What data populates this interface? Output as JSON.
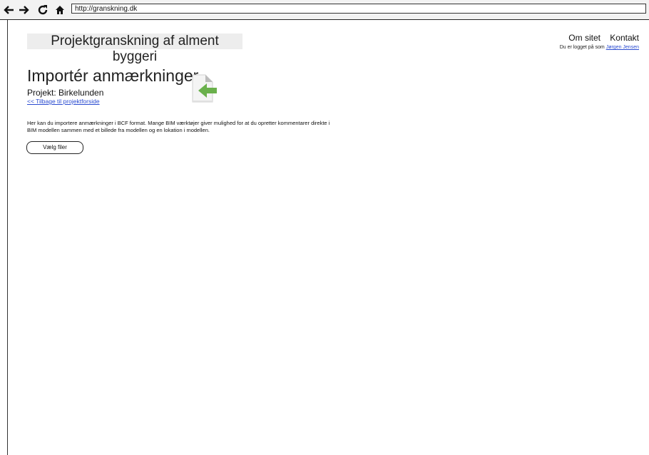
{
  "browser": {
    "url": "http://granskning.dk",
    "icons": [
      "back-arrow-icon",
      "forward-arrow-icon",
      "reload-icon",
      "home-icon"
    ]
  },
  "header": {
    "brand": "Projektgranskning af alment byggeri",
    "nav": {
      "about": "Om sitet",
      "contact": "Kontakt"
    },
    "login_prefix": "Du er logget på som",
    "user_name": "Jørgen Jensen"
  },
  "main": {
    "title": "Importér anmærkninger",
    "project": "Projekt: Birkelunden",
    "back_link": "<< Tilbage til projektforside",
    "description_line1": "Her kan du importere anmærkninger i BCF format. Mange BIM værktøjer giver mulighed for at du opretter kommentarer direkte i",
    "description_line2": "BIM modellen sammen med et billede fra modellen og en lokation i modellen.",
    "choose_files": "Vælg filer",
    "icon": "import-document-icon"
  },
  "colors": {
    "link": "#2a4bd0",
    "arrow": "#6ab04c",
    "brand_bg": "#ededed"
  }
}
